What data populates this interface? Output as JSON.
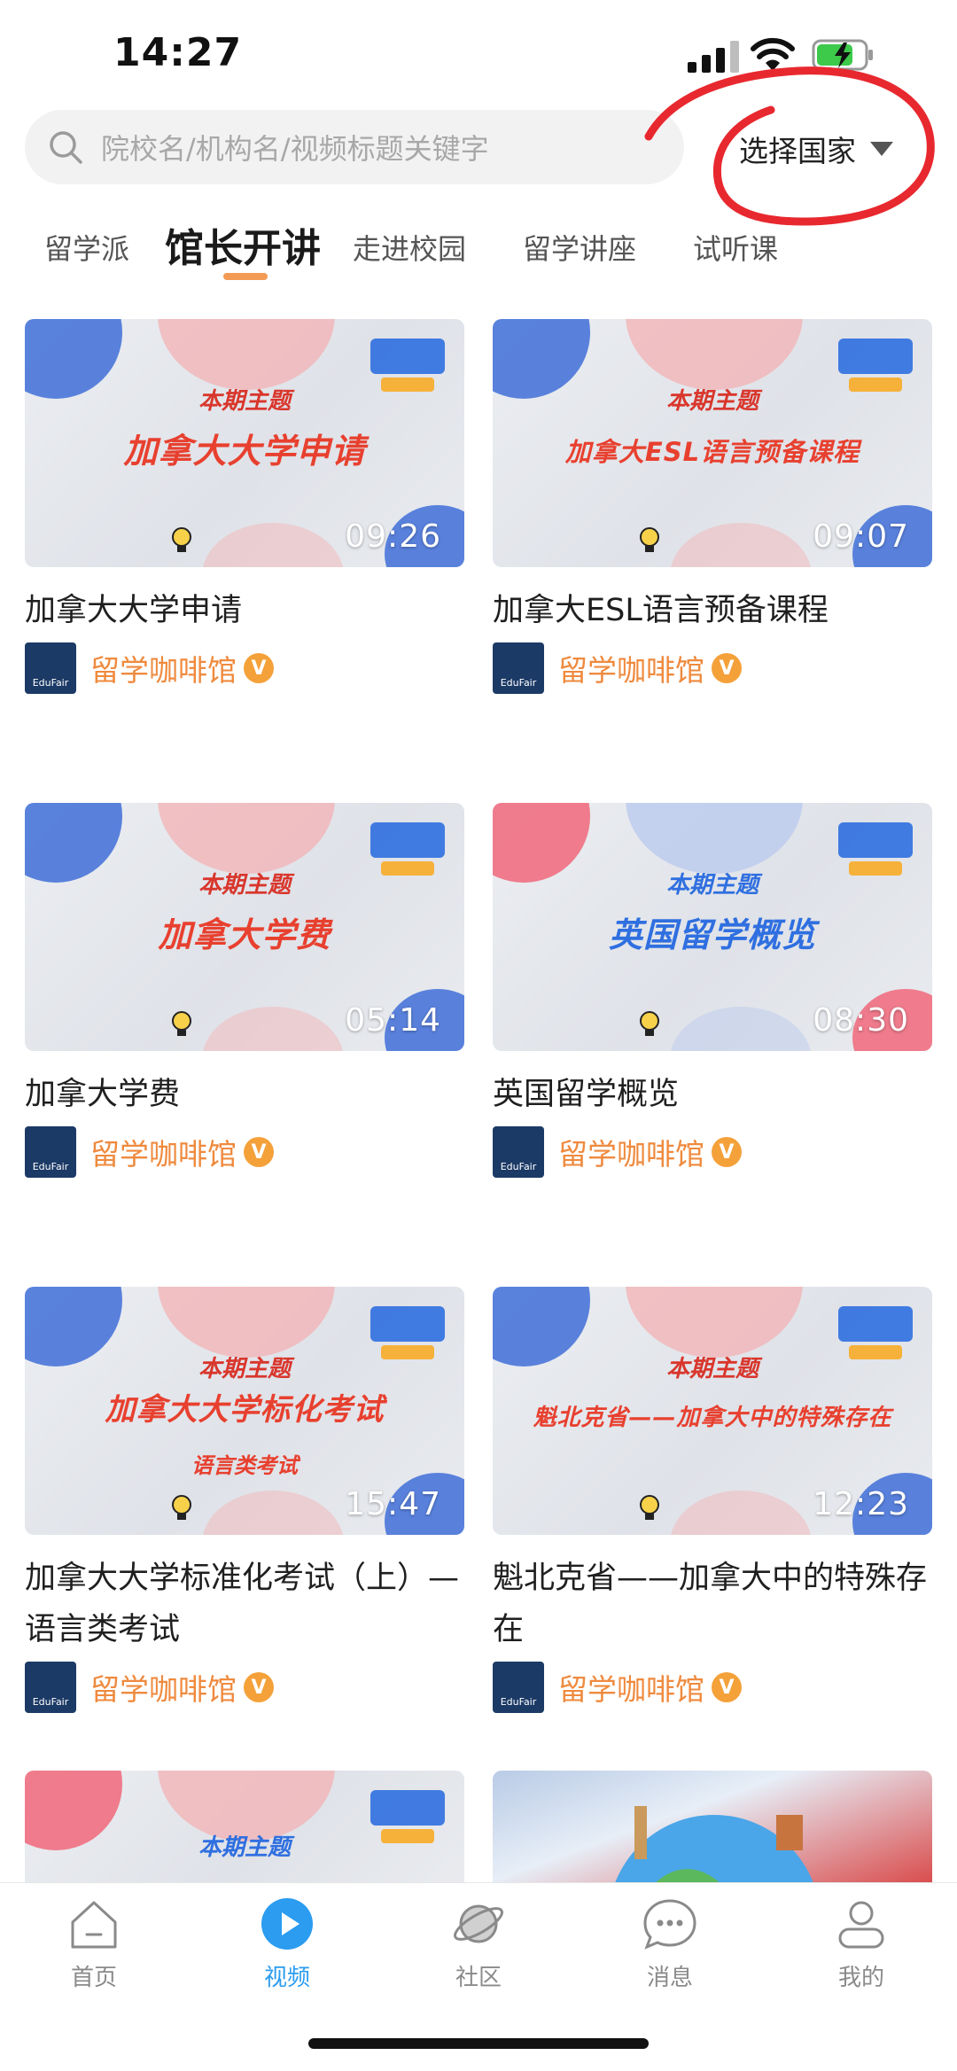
{
  "status_bar": {
    "time": "14:27"
  },
  "search": {
    "placeholder": "院校名/机构名/视频标题关键字"
  },
  "country_select": {
    "label": "选择国家"
  },
  "tabs": [
    {
      "label": "留学派",
      "active": false
    },
    {
      "label": "馆长开讲",
      "active": true
    },
    {
      "label": "走进校园",
      "active": false
    },
    {
      "label": "留学讲座",
      "active": false
    },
    {
      "label": "试听课",
      "active": false
    }
  ],
  "thumb_topic_label": "本期主题",
  "videos": [
    {
      "thumb_title": "加拿大大学申请",
      "duration": "09:26",
      "title": "加拿大大学申请",
      "author": "留学咖啡馆"
    },
    {
      "thumb_title": "加拿大ESL语言预备课程",
      "duration": "09:07",
      "title": "加拿大ESL语言预备课程",
      "author": "留学咖啡馆"
    },
    {
      "thumb_title": "加拿大学费",
      "duration": "05:14",
      "title": "加拿大学费",
      "author": "留学咖啡馆"
    },
    {
      "thumb_title": "英国留学概览",
      "duration": "08:30",
      "title": "英国留学概览",
      "author": "留学咖啡馆"
    },
    {
      "thumb_title": "加拿大大学标化考试",
      "thumb_sub": "语言类考试",
      "duration": "15:47",
      "title": "加拿大大学标准化考试（上）—语言类考试",
      "author": "留学咖啡馆"
    },
    {
      "thumb_title": "魁北克省——加拿大中的特殊存在",
      "duration": "12:23",
      "title": "魁北克省——加拿大中的特殊存在",
      "author": "留学咖啡馆"
    }
  ],
  "avatar_text": "EduFair",
  "verified_mark": "V",
  "bottom_nav": [
    {
      "label": "首页",
      "icon": "home-icon",
      "active": false
    },
    {
      "label": "视频",
      "icon": "play-icon",
      "active": true
    },
    {
      "label": "社区",
      "icon": "planet-icon",
      "active": false
    },
    {
      "label": "消息",
      "icon": "message-icon",
      "active": false
    },
    {
      "label": "我的",
      "icon": "profile-icon",
      "active": false
    }
  ],
  "colors": {
    "accent_orange": "#ef8a3e",
    "nav_active": "#2b9cf0",
    "annotation_red": "#e8282f"
  }
}
